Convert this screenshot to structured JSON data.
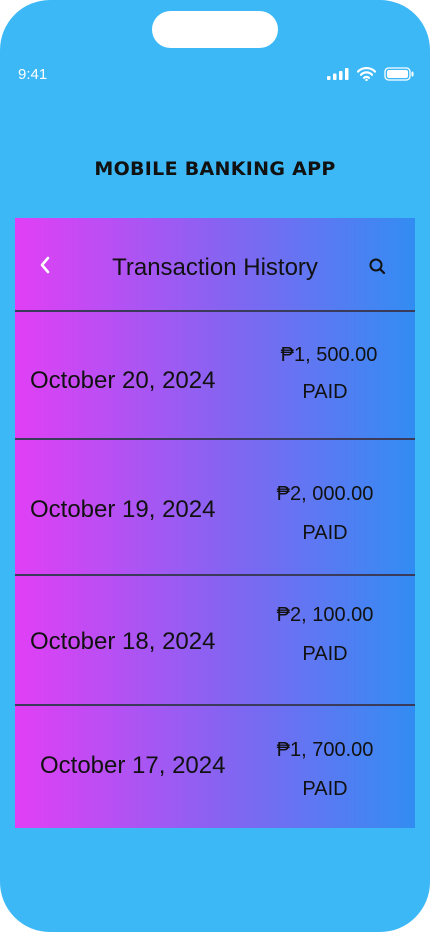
{
  "status_bar": {
    "time": "9:41",
    "icons": [
      "signal-icon",
      "wifi-icon",
      "battery-icon"
    ]
  },
  "app": {
    "title": "MOBILE BANKING APP"
  },
  "header": {
    "title": "Transaction History",
    "back_icon": "chevron-left-icon",
    "search_icon": "search-icon"
  },
  "transactions": [
    {
      "date": "October 20, 2024",
      "amount": "₱1, 500.00",
      "status": "PAID"
    },
    {
      "date": "October 19, 2024",
      "amount": "₱2, 000.00",
      "status": "PAID"
    },
    {
      "date": "October 18, 2024",
      "amount": "₱2, 100.00",
      "status": "PAID"
    },
    {
      "date": "October 17, 2024",
      "amount": "₱1, 700.00",
      "status": "PAID"
    }
  ],
  "colors": {
    "phone_background": "#3db8f6",
    "gradient_start": "#e23ff5",
    "gradient_end": "#328df2",
    "divider": "#3a3a5a"
  }
}
